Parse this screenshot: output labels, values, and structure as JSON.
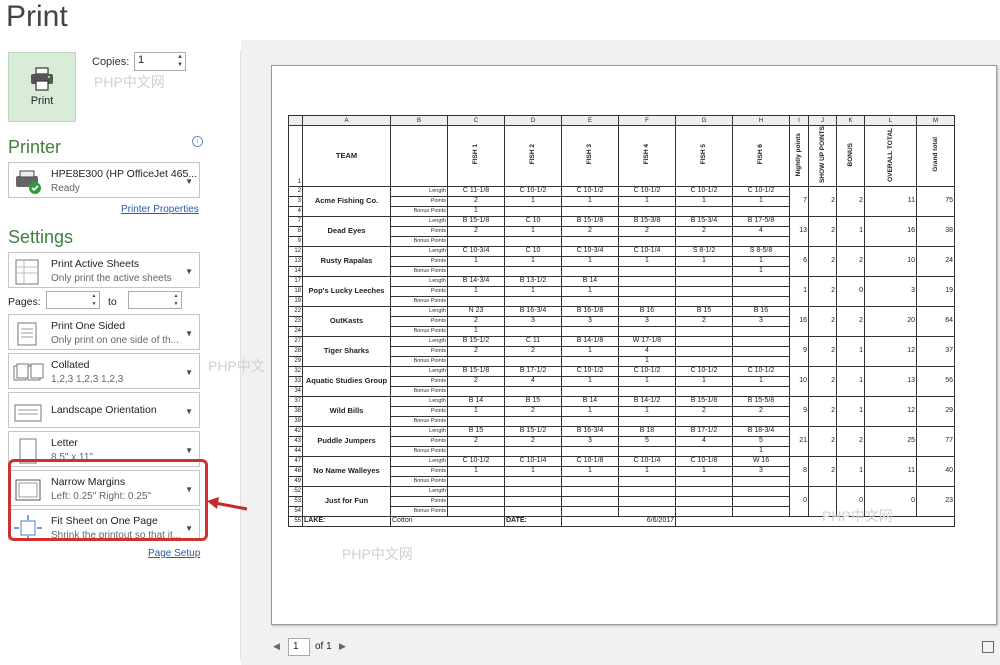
{
  "title": "Print",
  "print_button": {
    "label": "Print",
    "icon": "printer-icon"
  },
  "copies": {
    "label": "Copies:",
    "value": "1"
  },
  "printer": {
    "section": "Printer",
    "name": "HPE8E300 (HP OfficeJet 465...",
    "status": "Ready",
    "properties_link": "Printer Properties"
  },
  "settings": {
    "section": "Settings",
    "active_sheets": {
      "title": "Print Active Sheets",
      "desc": "Only print the active sheets"
    },
    "pages_label": "Pages:",
    "to_label": "to",
    "sided": {
      "title": "Print One Sided",
      "desc": "Only print on one side of th..."
    },
    "collated": {
      "title": "Collated",
      "desc": "1,2,3    1,2,3    1,2,3"
    },
    "orientation": {
      "title": "Landscape Orientation"
    },
    "paper": {
      "title": "Letter",
      "desc": "8.5\" x 11\""
    },
    "margins": {
      "title": "Narrow Margins",
      "desc": "Left: 0.25\"   Right: 0.25\""
    },
    "scaling": {
      "title": "Fit Sheet on One Page",
      "desc": "Shrink the printout so that it..."
    },
    "page_setup_link": "Page Setup"
  },
  "preview": {
    "columns": [
      "A",
      "B",
      "C",
      "D",
      "E",
      "F",
      "G",
      "H",
      "I",
      "J",
      "K",
      "L",
      "M"
    ],
    "headers": {
      "team": "TEAM",
      "fish": [
        "FISH 1",
        "FISH 2",
        "FISH 3",
        "FISH 4",
        "FISH 5",
        "FISH 6"
      ],
      "nightly": "Nightly points",
      "showup": "SHOW UP POINTS",
      "bonus": "BONUS",
      "overall": "OVERALL TOTAL",
      "grand": "Grand total"
    },
    "sub_labels": [
      "Length",
      "Points",
      "Bonus Points"
    ],
    "teams": [
      {
        "rows": [
          "2",
          "3",
          "4"
        ],
        "name": "Acme Fishing Co.",
        "length": [
          "C 11-1/8",
          "C 10-1/2",
          "C 10-1/2",
          "C 10-1/2",
          "C 10-1/2",
          "C 10-1/2"
        ],
        "points": [
          "2",
          "1",
          "1",
          "1",
          "1",
          "1"
        ],
        "bonus": [
          "1",
          "",
          "",
          "",
          "",
          ""
        ],
        "nightly": "7",
        "showup": "2",
        "bonusp": "2",
        "overall": "11",
        "grand": "75"
      },
      {
        "rows": [
          "7",
          "8",
          "9"
        ],
        "name": "Dead Eyes",
        "length": [
          "B 15-1/8",
          "C 10",
          "B 15-1/8",
          "B 15-3/8",
          "B 15-3/4",
          "B 17-5/8"
        ],
        "points": [
          "2",
          "1",
          "2",
          "2",
          "2",
          "4"
        ],
        "bonus": [
          "",
          "",
          "",
          "",
          "",
          ""
        ],
        "nightly": "13",
        "showup": "2",
        "bonusp": "1",
        "overall": "16",
        "grand": "38"
      },
      {
        "rows": [
          "12",
          "13",
          "14"
        ],
        "name": "Rusty Rapalas",
        "length": [
          "C 10-3/4",
          "C 10",
          "C 10-3/4",
          "C 10-1/4",
          "S 8-1/2",
          "S 8-5/8"
        ],
        "points": [
          "1",
          "1",
          "1",
          "1",
          "1",
          "1"
        ],
        "bonus": [
          "",
          "",
          "",
          "",
          "",
          "1"
        ],
        "nightly": "6",
        "showup": "2",
        "bonusp": "2",
        "overall": "10",
        "grand": "24"
      },
      {
        "rows": [
          "17",
          "18",
          "19"
        ],
        "name": "Pop's Lucky Leeches",
        "length": [
          "B 14-3/4",
          "B 13-1/2",
          "B 14",
          "",
          "",
          ""
        ],
        "points": [
          "1",
          "1",
          "1",
          "",
          "",
          ""
        ],
        "bonus": [
          "",
          "",
          "",
          "",
          "",
          ""
        ],
        "nightly": "1",
        "showup": "2",
        "bonusp": "0",
        "overall": "3",
        "grand": "19"
      },
      {
        "rows": [
          "22",
          "23",
          "24"
        ],
        "name": "OutKasts",
        "length": [
          "N 23",
          "B 16-3/4",
          "B 16-1/8",
          "B 16",
          "B 15",
          "B 16"
        ],
        "points": [
          "2",
          "3",
          "3",
          "3",
          "2",
          "3"
        ],
        "bonus": [
          "1",
          "",
          "",
          "",
          "",
          ""
        ],
        "nightly": "16",
        "showup": "2",
        "bonusp": "2",
        "overall": "20",
        "grand": "64"
      },
      {
        "rows": [
          "27",
          "28",
          "29"
        ],
        "name": "Tiger Sharks",
        "length": [
          "B 15-1/2",
          "C 11",
          "B 14-1/8",
          "W 17-1/8",
          "",
          ""
        ],
        "points": [
          "2",
          "2",
          "1",
          "4",
          "",
          ""
        ],
        "bonus": [
          "",
          "",
          "",
          "1",
          "",
          ""
        ],
        "nightly": "9",
        "showup": "2",
        "bonusp": "1",
        "overall": "12",
        "grand": "37"
      },
      {
        "rows": [
          "32",
          "33",
          "34"
        ],
        "name": "Aquatic Studies Group",
        "length": [
          "B 15-1/8",
          "B 17-1/2",
          "C 10-1/2",
          "C 10-1/2",
          "C 10-1/2",
          "C 10-1/2"
        ],
        "points": [
          "2",
          "4",
          "1",
          "1",
          "1",
          "1"
        ],
        "bonus": [
          "",
          "",
          "",
          "",
          "",
          ""
        ],
        "nightly": "10",
        "showup": "2",
        "bonusp": "1",
        "overall": "13",
        "grand": "56"
      },
      {
        "rows": [
          "37",
          "38",
          "39"
        ],
        "name": "Wild Bills",
        "length": [
          "B 14",
          "B 15",
          "B 14",
          "B 14-1/2",
          "B 15-1/8",
          "B 15-5/8"
        ],
        "points": [
          "1",
          "2",
          "1",
          "1",
          "2",
          "2"
        ],
        "bonus": [
          "",
          "",
          "",
          "",
          "",
          ""
        ],
        "nightly": "9",
        "showup": "2",
        "bonusp": "1",
        "overall": "12",
        "grand": "29"
      },
      {
        "rows": [
          "42",
          "43",
          "44"
        ],
        "name": "Puddle Jumpers",
        "length": [
          "B 15",
          "B 15-1/2",
          "B 16-3/4",
          "B 18",
          "B 17-1/2",
          "B 18-3/4"
        ],
        "points": [
          "2",
          "2",
          "3",
          "5",
          "4",
          "5"
        ],
        "bonus": [
          "",
          "",
          "",
          "",
          "",
          "1"
        ],
        "nightly": "21",
        "showup": "2",
        "bonusp": "2",
        "overall": "25",
        "grand": "77"
      },
      {
        "rows": [
          "47",
          "48",
          "49"
        ],
        "name": "No Name Walleyes",
        "length": [
          "C 10-1/2",
          "C 10-1/4",
          "C 10-1/8",
          "C 10-1/4",
          "C 10-1/8",
          "W 16"
        ],
        "points": [
          "1",
          "1",
          "1",
          "1",
          "1",
          "3"
        ],
        "bonus": [
          "",
          "",
          "",
          "",
          "",
          ""
        ],
        "nightly": "8",
        "showup": "2",
        "bonusp": "1",
        "overall": "11",
        "grand": "40"
      },
      {
        "rows": [
          "52",
          "53",
          "54"
        ],
        "name": "Just for Fun",
        "length": [
          "",
          "",
          "",
          "",
          "",
          ""
        ],
        "points": [
          "",
          "",
          "",
          "",
          "",
          ""
        ],
        "bonus": [
          "",
          "",
          "",
          "",
          "",
          ""
        ],
        "nightly": "0",
        "showup": "",
        "bonusp": "0",
        "overall": "0",
        "grand": "23"
      }
    ],
    "footer": {
      "row": "55",
      "lake_label": "LAKE:",
      "lake_value": "Cotton",
      "date_label": "DATE:",
      "date_value": "6/6/2017"
    }
  },
  "pager": {
    "current": "1",
    "of": "of 1"
  },
  "watermarks": [
    "PHP中文网",
    "PHP中文",
    "PHP中文网",
    "PHP中文网"
  ]
}
